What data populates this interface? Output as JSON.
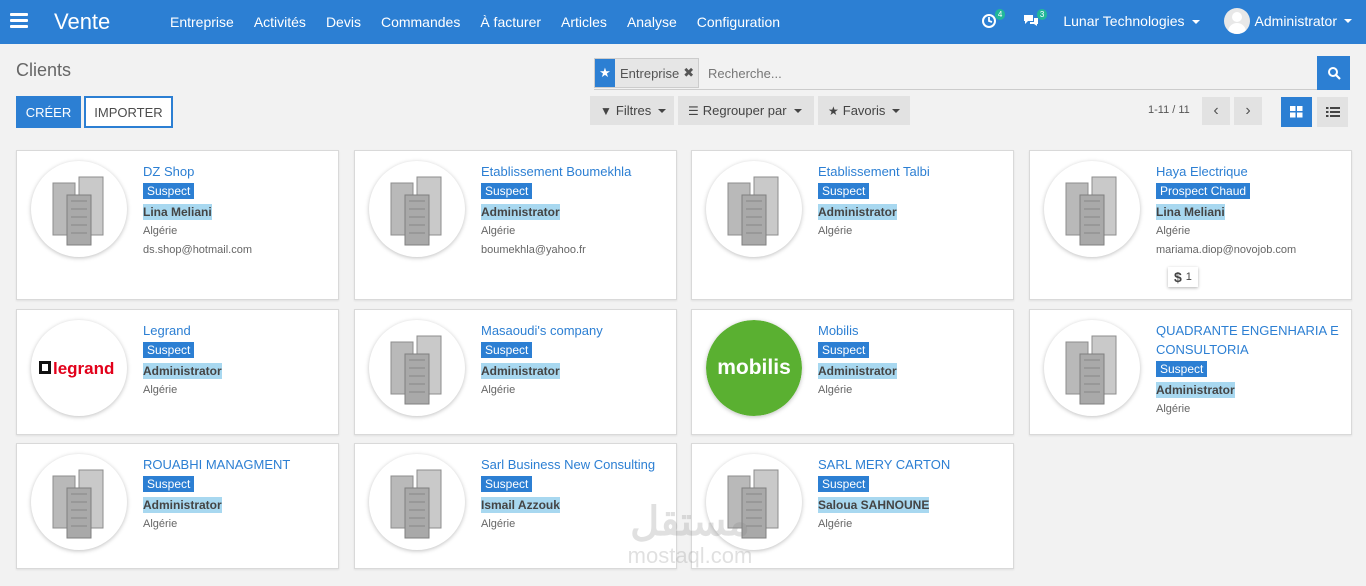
{
  "navbar": {
    "app_name": "Vente",
    "menu": [
      "Entreprise",
      "Activités",
      "Devis",
      "Commandes",
      "À facturer",
      "Articles",
      "Analyse",
      "Configuration"
    ],
    "activity_count": "4",
    "messages_count": "3",
    "company": "Lunar Technologies",
    "user": "Administrator"
  },
  "control_panel": {
    "breadcrumb": "Clients",
    "create_label": "CRÉER",
    "import_label": "IMPORTER",
    "facet_label": "Entreprise",
    "search_placeholder": "Recherche...",
    "filters_label": "Filtres",
    "groupby_label": "Regrouper par",
    "favorites_label": "Favoris",
    "pager": "1-11 / 11"
  },
  "cards": [
    {
      "name": "DZ Shop",
      "tag": "Suspect",
      "salesperson": "Lina Meliani",
      "country": "Algérie",
      "email": "ds.shop@hotmail.com",
      "logo": "building"
    },
    {
      "name": "Etablissement Boumekhla",
      "tag": "Suspect",
      "salesperson": "Administrator",
      "country": "Algérie",
      "email": "boumekhla@yahoo.fr",
      "logo": "building"
    },
    {
      "name": "Etablissement Talbi",
      "tag": "Suspect",
      "salesperson": "Administrator",
      "country": "Algérie",
      "email": "",
      "logo": "building"
    },
    {
      "name": "Haya Electrique",
      "tag": "Prospect Chaud",
      "salesperson": "Lina Meliani",
      "country": "Algérie",
      "email": "mariama.diop@novojob.com",
      "logo": "building",
      "opportunities": "1"
    },
    {
      "name": "Legrand",
      "tag": "Suspect",
      "salesperson": "Administrator",
      "country": "Algérie",
      "email": "",
      "logo": "legrand",
      "logo_text": "legrand"
    },
    {
      "name": "Masaoudi's company",
      "tag": "Suspect",
      "salesperson": "Administrator",
      "country": "Algérie",
      "email": "",
      "logo": "building"
    },
    {
      "name": "Mobilis",
      "tag": "Suspect",
      "salesperson": "Administrator",
      "country": "Algérie",
      "email": "",
      "logo": "mobilis",
      "logo_text": "mobilis"
    },
    {
      "name": "QUADRANTE ENGENHARIA E CONSULTORIA",
      "tag": "Suspect",
      "salesperson": "Administrator",
      "country": "Algérie",
      "email": "",
      "logo": "building"
    },
    {
      "name": "ROUABHI MANAGMENT",
      "tag": "Suspect",
      "salesperson": "Administrator",
      "country": "Algérie",
      "email": "",
      "logo": "building"
    },
    {
      "name": "Sarl Business New Consulting",
      "tag": "Suspect",
      "salesperson": "Ismail Azzouk",
      "country": "Algérie",
      "email": "",
      "logo": "building"
    },
    {
      "name": "SARL MERY CARTON",
      "tag": "Suspect",
      "salesperson": "Saloua SAHNOUNE",
      "country": "Algérie",
      "email": "",
      "logo": "building"
    }
  ],
  "watermark": {
    "arabic": "مستقل",
    "latin": "mostaql.com"
  },
  "colors": {
    "primary": "#2c7fd3",
    "salesperson_bg": "#a8d8f0",
    "mobilis_green": "#5ab031",
    "legrand_red": "#e2001a"
  }
}
